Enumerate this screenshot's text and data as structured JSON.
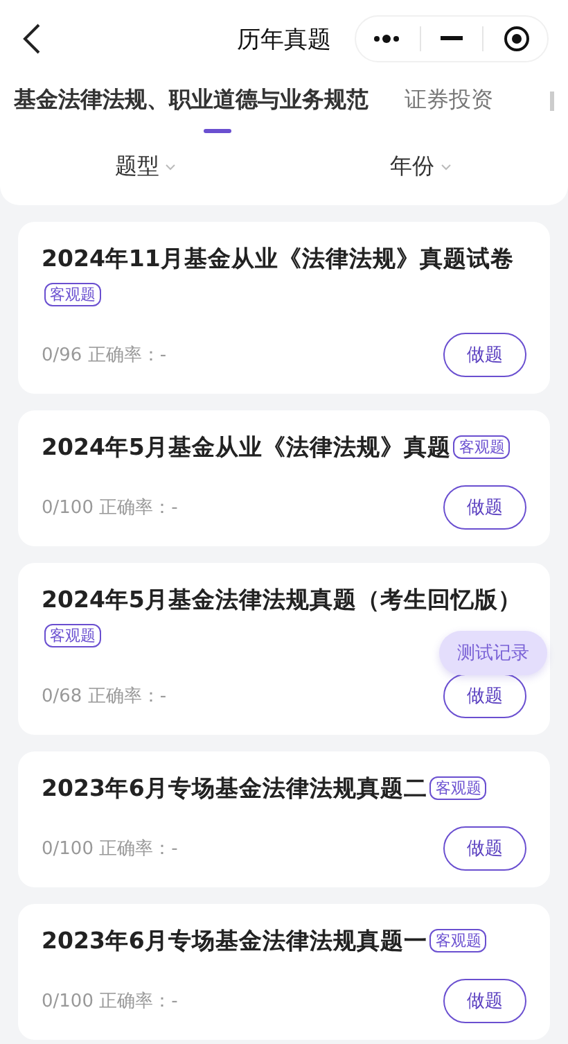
{
  "window": {
    "title": "历年真题"
  },
  "tabs": [
    {
      "label": "基金法律法规、职业道德与业务规范",
      "selected": true
    },
    {
      "label": "证券投资",
      "selected": false
    }
  ],
  "filters": [
    {
      "label": "题型"
    },
    {
      "label": "年份"
    }
  ],
  "papers": [
    {
      "title": "2024年11月基金从业《法律法规》真题试卷",
      "tag": "客观题",
      "progress": "0/96 正确率：-",
      "button": "做题"
    },
    {
      "title": "2024年5月基金从业《法律法规》真题",
      "tag": "客观题",
      "progress": "0/100 正确率：-",
      "button": "做题"
    },
    {
      "title": "2024年5月基金法律法规真题（考生回忆版）",
      "tag": "客观题",
      "progress": "0/68 正确率：-",
      "button": "做题"
    },
    {
      "title": "2023年6月专场基金法律法规真题二",
      "tag": "客观题",
      "progress": "0/100 正确率：-",
      "button": "做题"
    },
    {
      "title": "2023年6月专场基金法律法规真题一",
      "tag": "客观题",
      "progress": "0/100 正确率：-",
      "button": "做题"
    }
  ],
  "floating_button": {
    "label": "测试记录"
  }
}
